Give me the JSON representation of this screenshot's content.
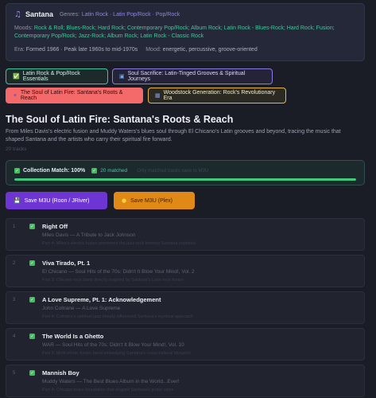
{
  "artist": {
    "name": "Santana",
    "genres_label": "Genres:",
    "genres": "Latin Rock · Latin Pop/Rock · Pop/Rock",
    "moods_label": "Moods:",
    "moods": "Rock & Roll; Blues-Rock; Hard Rock; Contemporary Pop/Rock; Album Rock; Latin Rock - Blues-Rock; Hard Rock; Fusion; Contemporary Pop/Rock; Jazz-Rock; Album Rock; Latin Rock - Classic Rock",
    "era_label": "Era:",
    "era": "Formed 1966 · Peak late 1960s to mid-1970s",
    "mood_label": "Mood:",
    "mood": "energetic, percussive, groove-oriented"
  },
  "tabs": [
    {
      "label": "Latin Rock & Pop/Rock Essentials",
      "icon": "check-icon"
    },
    {
      "label": "Soul Sacrifice: Latin-Tinged Grooves & Spiritual Journeys",
      "icon": "photo-icon"
    },
    {
      "label": "The Soul of Latin Fire: Santana's Roots & Reach",
      "icon": "sparkle-icon"
    },
    {
      "label": "Woodstock Generation: Rock's Revolutionary Era",
      "icon": "calendar-icon"
    }
  ],
  "playlist": {
    "title": "The Soul of Latin Fire: Santana's Roots & Reach",
    "description": "From Miles Davis's electric fusion and Muddy Waters's blues soul through El Chicano's Latin grooves and beyond, tracing the music that shaped Santana and the artists who carry their spiritual fire forward.",
    "track_count": "20 tracks"
  },
  "match": {
    "title": "Collection Match: 100%",
    "matched": "20 matched",
    "hint": "Only matched tracks save to M3U",
    "progress": 1.0
  },
  "buttons": {
    "save_roon": "Save M3U (Roon / JRiver)",
    "save_plex": "Save M3U (Plex)"
  },
  "tracks": [
    {
      "num": "1",
      "title": "Right Off",
      "artist": "Miles Davis — A Tribute to Jack Johnson",
      "note": "Part 4: Miles's electric fusion pioneered the jazz-rock territory Santana explored"
    },
    {
      "num": "2",
      "title": "Viva Tirado, Pt. 1",
      "artist": "El Chicano — Soul Hits of the 70s: Didn't It Blow Your Mind!, Vol. 2",
      "note": "Part 3: Chicano rock band directly inspired by Santana's Latin rock fusion"
    },
    {
      "num": "3",
      "title": "A Love Supreme, Pt. 1: Acknowledgement",
      "artist": "John Coltrane — A Love Supreme",
      "note": "Part 4: Coltrane's spiritual jazz deeply influenced Santana's mystical approach"
    },
    {
      "num": "4",
      "title": "The World Is a Ghetto",
      "artist": "WAR — Soul Hits of the 70s: Didn't It Blow Your Mind!, Vol. 10",
      "note": "Part 3: Multi-ethnic fusion band embodying Santana's cross-cultural blueprint"
    },
    {
      "num": "5",
      "title": "Mannish Boy",
      "artist": "Muddy Waters — The Best Blues Album in the World...Ever!",
      "note": "Part 4: Chicago blues foundation that shaped Santana's guitar voice"
    }
  ],
  "colors": {
    "background": "#1a1d26",
    "accent_green": "#44c79a",
    "accent_purple": "#8c86e8",
    "active_tab": "#f46a6a",
    "roon_button": "#6d35d4",
    "plex_button": "#e08916"
  }
}
